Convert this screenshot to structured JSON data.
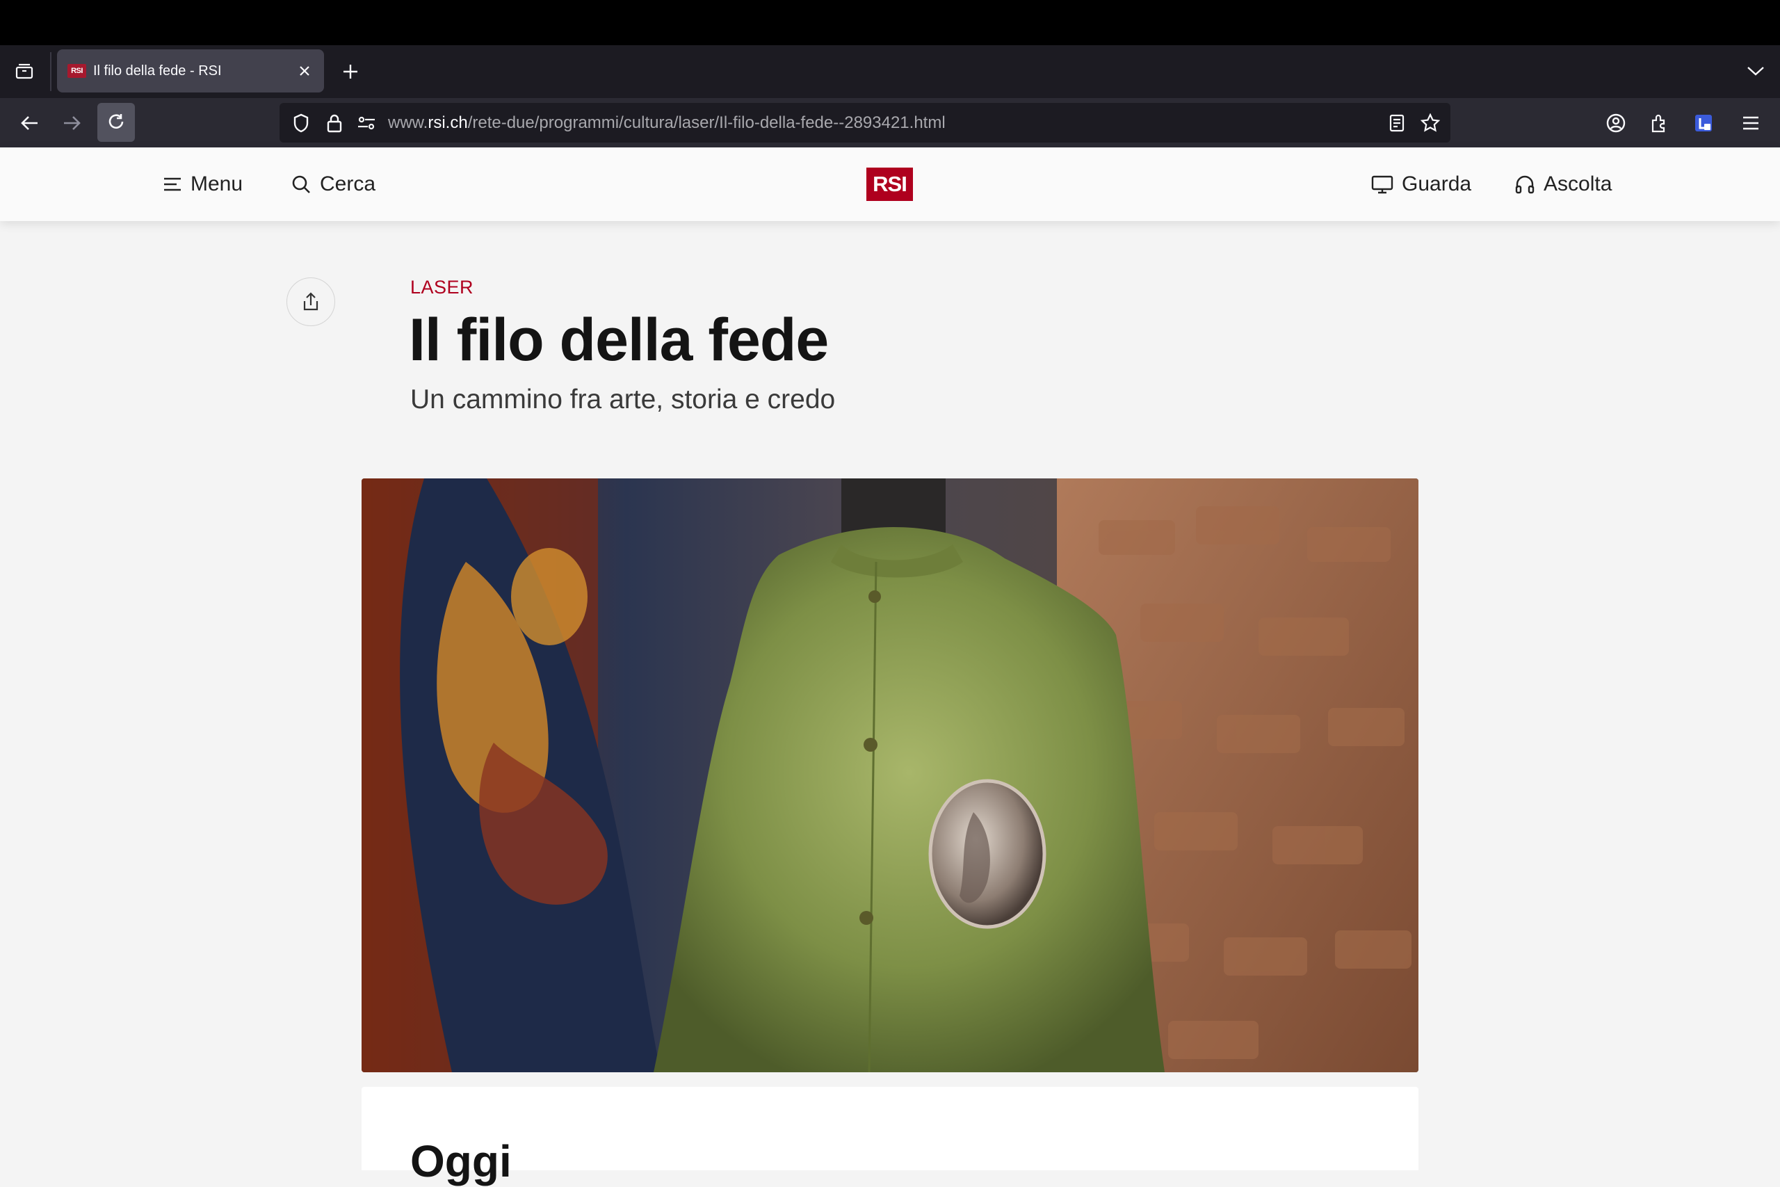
{
  "browser": {
    "tab": {
      "title": "Il filo della fede - RSI",
      "favicon_text": "RSI"
    },
    "url": {
      "prefix": "www.",
      "host": "rsi.ch",
      "path": "/rete-due/programmi/cultura/laser/Il-filo-della-fede--2893421.html"
    },
    "icons": [
      "tab-overview-icon",
      "new-tab-plus-icon",
      "list-all-tabs-chevron-icon",
      "back-arrow-icon",
      "forward-arrow-icon",
      "reload-icon",
      "tracking-shield-icon",
      "lock-icon",
      "permissions-icon",
      "reader-view-icon",
      "bookmark-star-icon",
      "account-icon",
      "extensions-icon",
      "extension-badge-icon",
      "app-menu-icon"
    ]
  },
  "site": {
    "logo_text": "RSI",
    "nav": {
      "menu": "Menu",
      "search": "Cerca",
      "watch": "Guarda",
      "listen": "Ascolta"
    },
    "brand_color": "#af001e"
  },
  "article": {
    "kicker": "LASER",
    "title": "Il filo della fede",
    "subtitle": "Un cammino fra arte, storia e credo",
    "section_heading": "Oggi"
  }
}
